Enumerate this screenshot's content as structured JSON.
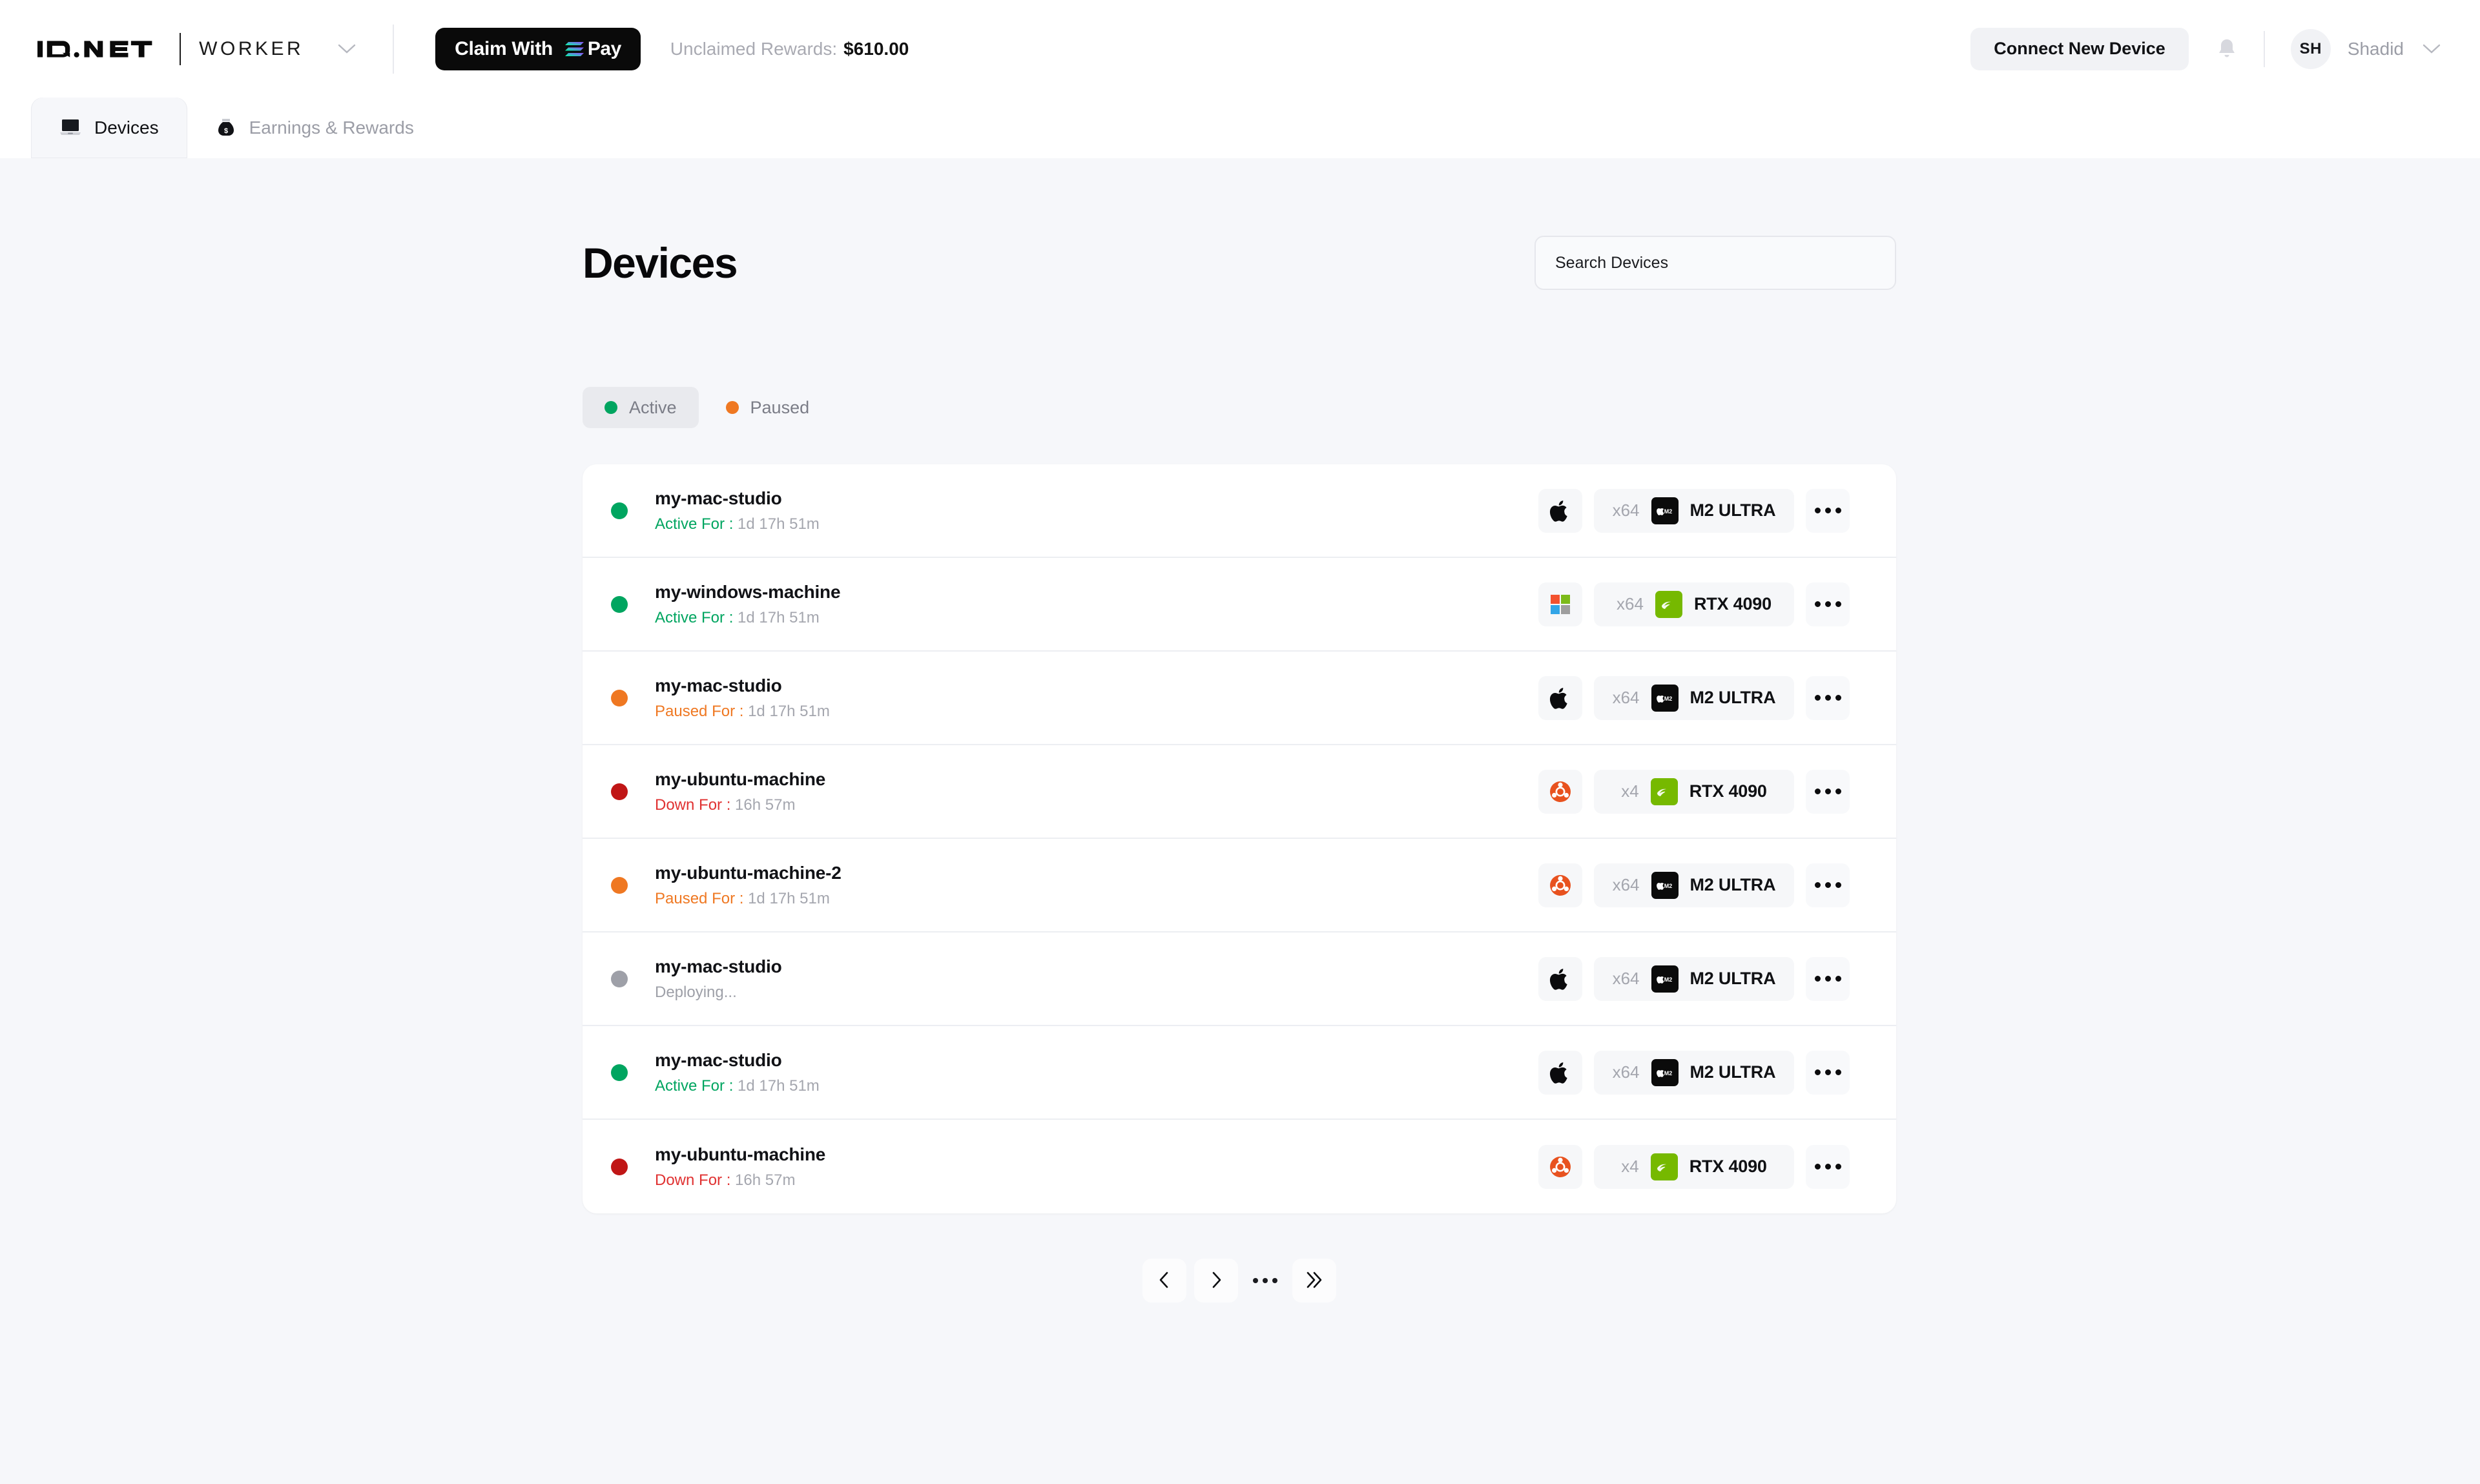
{
  "header": {
    "brand": "io.net",
    "product": "WORKER",
    "brand_dropdown_icon": "chevron-down-icon",
    "claim_button": {
      "label": "Claim With",
      "pay_label": "Pay",
      "icon": "solana-icon"
    },
    "unclaimed": {
      "label": "Unclaimed Rewards:",
      "value": "$610.00"
    },
    "connect_button": "Connect New Device",
    "notifications_icon": "bell-icon",
    "user": {
      "initials": "SH",
      "name": "Shadid",
      "chevron": "chevron-down-icon"
    }
  },
  "tabs": [
    {
      "label": "Devices",
      "icon": "laptop-icon",
      "active": true
    },
    {
      "label": "Earnings & Rewards",
      "icon": "money-bag-icon",
      "active": false
    }
  ],
  "main": {
    "title": "Devices",
    "search_placeholder": "Search Devices",
    "filters": [
      {
        "label": "Active",
        "color": "#00a560",
        "selected": true
      },
      {
        "label": "Paused",
        "color": "#ef7822",
        "selected": false
      }
    ]
  },
  "devices": [
    {
      "name": "my-mac-studio",
      "status_label": "Active For :",
      "status_time": "1d 17h 51m",
      "status_color": "#00a560",
      "status_text_color": "#00a560",
      "os": "apple-icon",
      "cores": "x64",
      "gpu": "M2 ULTRA",
      "gpu_vendor": "apple",
      "menu": "more-options-icon"
    },
    {
      "name": "my-windows-machine",
      "status_label": "Active For :",
      "status_time": "1d 17h 51m",
      "status_color": "#00a560",
      "status_text_color": "#00a560",
      "os": "windows-icon",
      "cores": "x64",
      "gpu": "RTX 4090",
      "gpu_vendor": "nvidia",
      "menu": "more-options-icon"
    },
    {
      "name": "my-mac-studio",
      "status_label": "Paused For :",
      "status_time": "1d 17h 51m",
      "status_color": "#ef7822",
      "status_text_color": "#ef7822",
      "os": "apple-icon",
      "cores": "x64",
      "gpu": "M2 ULTRA",
      "gpu_vendor": "apple",
      "menu": "more-options-icon"
    },
    {
      "name": "my-ubuntu-machine",
      "status_label": "Down For :",
      "status_time": "16h 57m",
      "status_color": "#c01616",
      "status_text_color": "#e03131",
      "os": "ubuntu-icon",
      "cores": "x4",
      "gpu": "RTX 4090",
      "gpu_vendor": "nvidia",
      "menu": "more-options-icon"
    },
    {
      "name": "my-ubuntu-machine-2",
      "status_label": "Paused For :",
      "status_time": "1d 17h 51m",
      "status_color": "#ef7822",
      "status_text_color": "#ef7822",
      "os": "ubuntu-icon",
      "cores": "x64",
      "gpu": "M2 ULTRA",
      "gpu_vendor": "apple",
      "menu": "more-options-icon"
    },
    {
      "name": "my-mac-studio",
      "status_label": "Deploying...",
      "status_time": "",
      "status_color": "#9ea0a8",
      "status_text_color": "#9ea0a8",
      "os": "apple-icon",
      "cores": "x64",
      "gpu": "M2 ULTRA",
      "gpu_vendor": "apple",
      "menu": "more-options-icon"
    },
    {
      "name": "my-mac-studio",
      "status_label": "Active For :",
      "status_time": "1d 17h 51m",
      "status_color": "#00a560",
      "status_text_color": "#00a560",
      "os": "apple-icon",
      "cores": "x64",
      "gpu": "M2 ULTRA",
      "gpu_vendor": "apple",
      "menu": "more-options-icon"
    },
    {
      "name": "my-ubuntu-machine",
      "status_label": "Down For :",
      "status_time": "16h 57m",
      "status_color": "#c01616",
      "status_text_color": "#e03131",
      "os": "ubuntu-icon",
      "cores": "x4",
      "gpu": "RTX 4090",
      "gpu_vendor": "nvidia",
      "menu": "more-options-icon"
    }
  ],
  "pagination": [
    {
      "icon": "chevron-left-icon",
      "name": "prev-page"
    },
    {
      "icon": "chevron-right-icon",
      "name": "next-page"
    },
    {
      "icon": "ellipsis-icon",
      "name": "more-pages"
    },
    {
      "icon": "chevron-double-right-icon",
      "name": "last-page"
    }
  ]
}
